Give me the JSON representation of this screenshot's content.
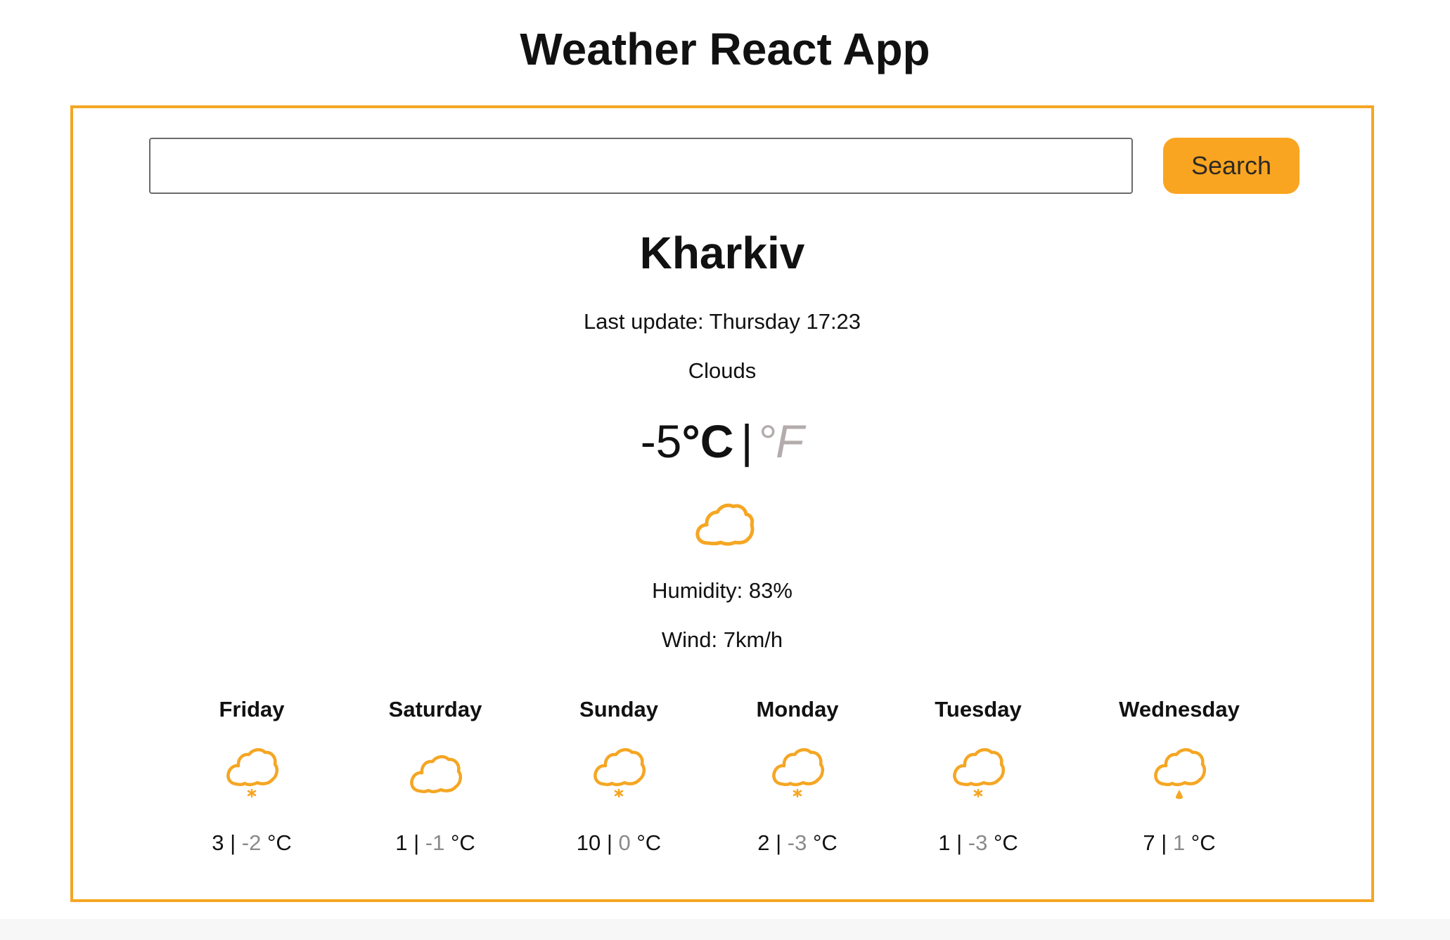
{
  "app": {
    "title": "Weather React App"
  },
  "search": {
    "value": "",
    "placeholder": "",
    "button_label": "Search"
  },
  "current": {
    "city": "Kharkiv",
    "last_update": "Last update: Thursday 17:23",
    "description": "Clouds",
    "temperature": "-5",
    "unit_celsius": "°C",
    "separator": "|",
    "unit_fahrenheit": "°F",
    "icon": "cloud-icon",
    "humidity": "Humidity: 83%",
    "wind": "Wind: 7km/h"
  },
  "forecast": [
    {
      "day": "Friday",
      "max": "3",
      "sep": " | ",
      "min": "-2",
      "unit": " °C",
      "icon": "cloud-snow-icon"
    },
    {
      "day": "Saturday",
      "max": "1",
      "sep": " | ",
      "min": "-1",
      "unit": " °C",
      "icon": "cloud-icon"
    },
    {
      "day": "Sunday",
      "max": "10",
      "sep": " | ",
      "min": "0",
      "unit": " °C",
      "icon": "cloud-snow-icon"
    },
    {
      "day": "Monday",
      "max": "2",
      "sep": " | ",
      "min": "-3",
      "unit": " °C",
      "icon": "cloud-snow-icon"
    },
    {
      "day": "Tuesday",
      "max": "1",
      "sep": " | ",
      "min": "-3",
      "unit": " °C",
      "icon": "cloud-snow-icon"
    },
    {
      "day": "Wednesday",
      "max": "7",
      "sep": " | ",
      "min": "1",
      "unit": " °C",
      "icon": "cloud-rain-icon"
    }
  ],
  "colors": {
    "accent": "#f5a623",
    "button": "#faa521",
    "fahrenheit_inactive": "#b4acac",
    "min_temp": "#8a8a8a"
  }
}
